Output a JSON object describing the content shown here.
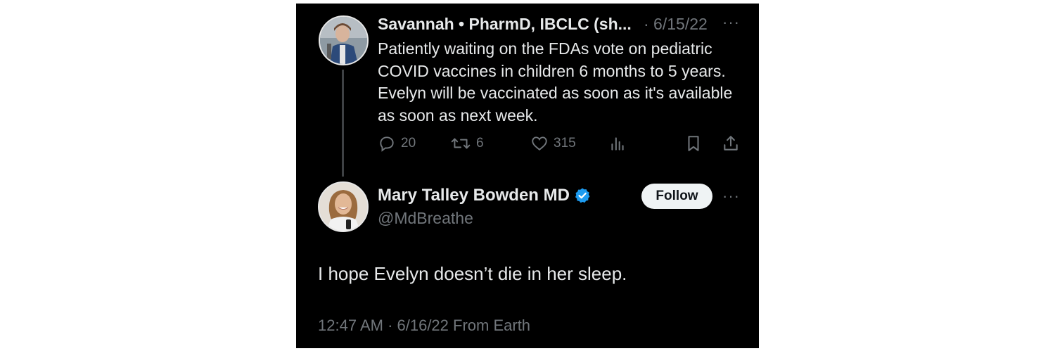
{
  "parent_tweet": {
    "author_name": "Savannah • PharmD, IBCLC (sh...",
    "date": "· 6/15/22",
    "text": "Patiently waiting on the FDAs vote on pediatric COVID vaccines in children 6 months to 5 years. Evelyn will be vaccinated as soon as it's available as soon as next week.",
    "reply_count": "20",
    "retweet_count": "6",
    "like_count": "315"
  },
  "reply_tweet": {
    "author_name": "Mary Talley Bowden MD",
    "handle": "@MdBreathe",
    "follow_label": "Follow",
    "text": "I hope Evelyn doesn’t die in her sleep.",
    "meta": "12:47 AM · 6/16/22 From Earth"
  },
  "colors": {
    "background": "#000000",
    "primary_text": "#e7e9ea",
    "secondary_text": "#71767b",
    "verified_badge": "#1d9bf0",
    "follow_button_bg": "#eff3f4"
  }
}
